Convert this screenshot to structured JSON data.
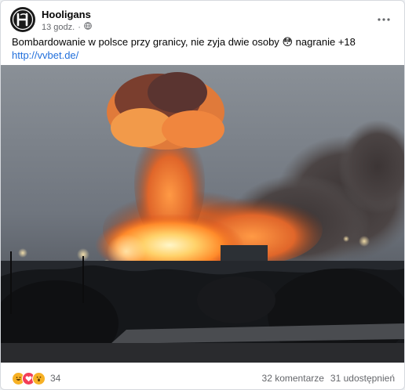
{
  "post": {
    "author": "Hooligans",
    "time": "13 godz.",
    "separator": "·",
    "text_main": "Bombardowanie w polsce przy granicy, nie zyja dwie osoby",
    "text_emoji": "😳",
    "text_tail": "nagranie +18",
    "link": "http://vvbet.de/",
    "privacy_icon": "globe-icon",
    "more_icon": "ellipsis-icon"
  },
  "footer": {
    "reactions": [
      "haha",
      "love",
      "wow"
    ],
    "reaction_count": "34",
    "comments": "32 komentarze",
    "shares": "31 udostępnień"
  },
  "colors": {
    "link": "#216fdb",
    "secondary_text": "#65676b",
    "haha": "#f7b125",
    "love": "#f33e58",
    "wow": "#f7b125"
  }
}
